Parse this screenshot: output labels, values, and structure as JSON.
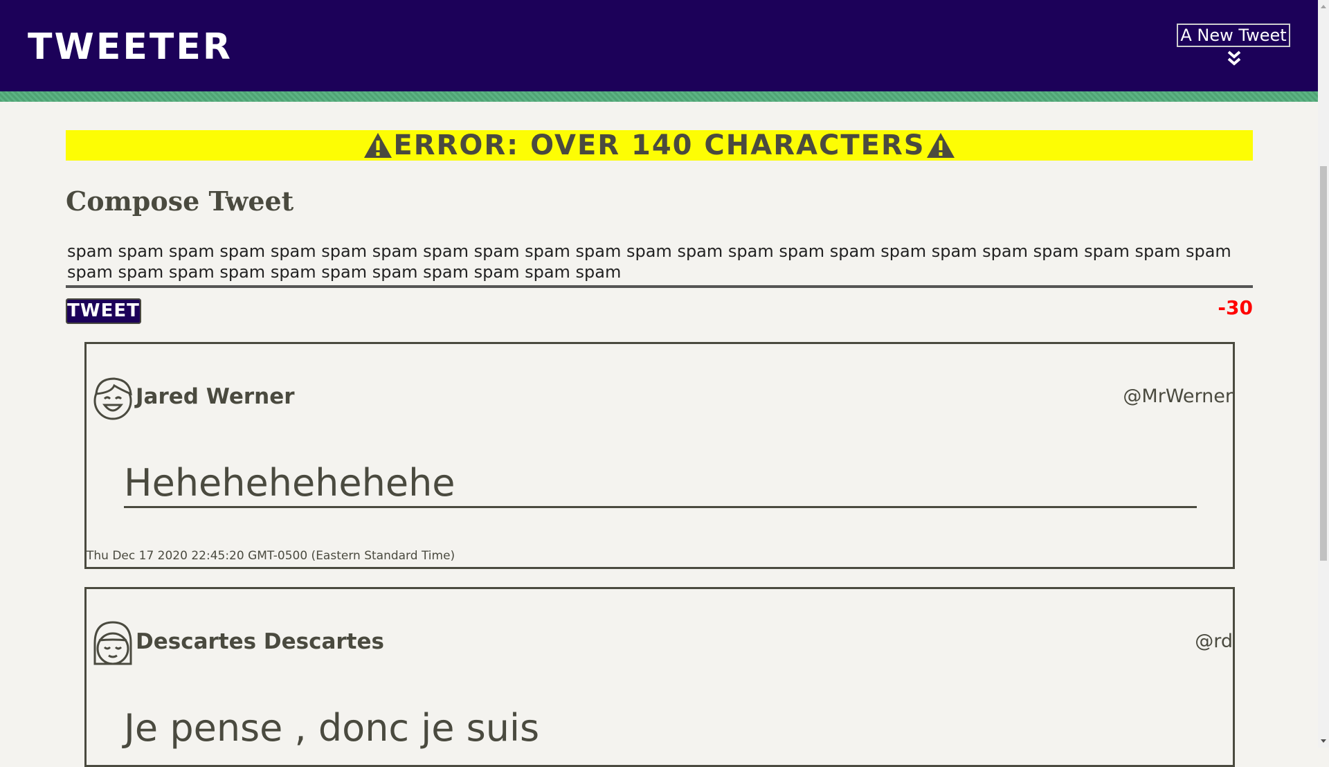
{
  "nav": {
    "brand": "Tweeter",
    "new_tweet_label": "A New Tweet",
    "new_tweet_icon": "double-chevron-down-icon"
  },
  "error": {
    "message": "Error: over 140 characters",
    "icon": "warning-icon"
  },
  "compose": {
    "title": "Compose Tweet",
    "text": "spam spam spam spam spam spam spam spam spam spam spam spam spam spam spam spam spam spam spam spam spam spam spam spam spam spam spam spam spam spam spam spam spam spam",
    "tweet_button": "Tweet",
    "counter": "-30"
  },
  "tweets": [
    {
      "name": "Jared Werner",
      "handle": "@MrWerner",
      "avatar": "male-avatar-icon",
      "body": "Hehehehehehehe",
      "date": "Thu Dec 17 2020 22:45:20 GMT-0500 (Eastern Standard Time)"
    },
    {
      "name": "Descartes Descartes",
      "handle": "@rd",
      "avatar": "female-avatar-icon",
      "body": "Je pense , donc je suis",
      "date": ""
    }
  ],
  "colors": {
    "nav_bg": "#1c0159",
    "stripe": "#4fa374",
    "error_bg": "#fdfd04",
    "counter": "#ff0000",
    "page_bg": "#f4f3ef"
  }
}
